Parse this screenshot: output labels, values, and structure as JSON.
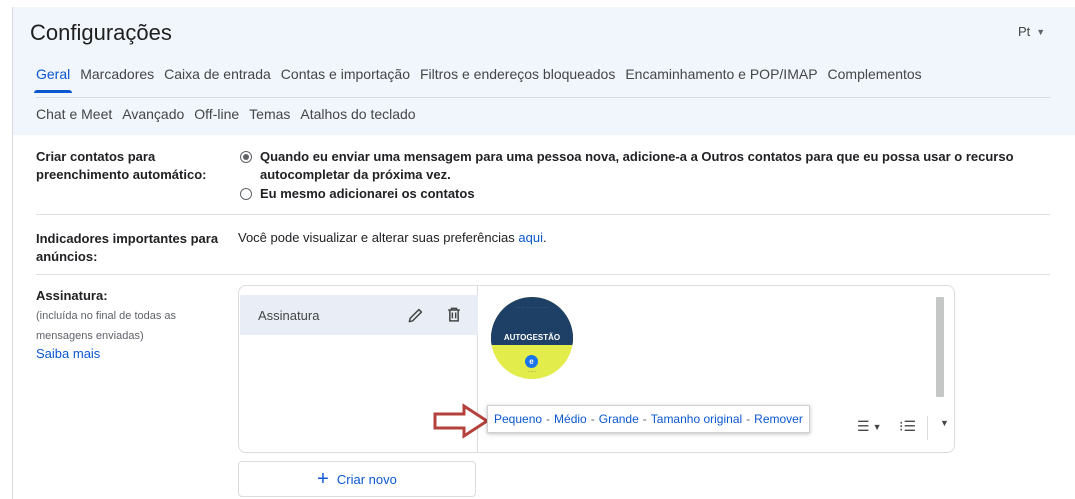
{
  "header": {
    "title": "Configurações",
    "lang_label": "Pt",
    "tabs_row1": [
      "Geral",
      "Marcadores",
      "Caixa de entrada",
      "Contas e importação",
      "Filtros e endereços bloqueados",
      "Encaminhamento e POP/IMAP",
      "Complementos"
    ],
    "tabs_row2": [
      "Chat e Meet",
      "Avançado",
      "Off-line",
      "Temas",
      "Atalhos do teclado"
    ],
    "active_tab": "Geral"
  },
  "contacts": {
    "label": "Criar contatos para preenchimento automático:",
    "option1": "Quando eu enviar uma mensagem para uma pessoa nova, adicione-a a Outros contatos para que eu possa usar o recurso autocompletar da próxima vez.",
    "option2": "Eu mesmo adicionarei os contatos",
    "selected": "option1"
  },
  "indicators": {
    "label": "Indicadores importantes para anúncios:",
    "text": "Você pode visualizar e alterar suas preferências ",
    "link": "aqui",
    "suffix": "."
  },
  "signature": {
    "label": "Assinatura:",
    "sub": "(incluída no final de todas as mensagens enviadas)",
    "learn_more": "Saiba mais",
    "item_name": "Assinatura",
    "image_text": "AUTOGESTÃO",
    "create_new": "Criar novo"
  },
  "image_size_popup": {
    "options": [
      "Pequeno",
      "Médio",
      "Grande",
      "Tamanho original",
      "Remover"
    ]
  },
  "colors": {
    "accent": "#0b57d0",
    "header_bg": "#f1f5fc",
    "arrow": "#b4413c",
    "badge_navy": "#1e3f66",
    "badge_yellow": "#e2ec4a"
  }
}
